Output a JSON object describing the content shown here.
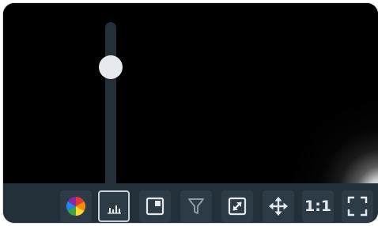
{
  "viewer": {
    "brightness_slider_level": 0.25
  },
  "toolbar": {
    "tools": [
      {
        "icon": "color-wheel-icon",
        "active": false
      },
      {
        "icon": "histogram-icon",
        "active": true
      },
      {
        "icon": "picture-in-picture-icon",
        "active": false
      },
      {
        "icon": "filter-icon",
        "active": false
      },
      {
        "icon": "resize-icon",
        "active": false
      },
      {
        "icon": "move-icon",
        "active": false
      },
      {
        "icon": "actual-size-icon",
        "label": "1:1",
        "active": false
      },
      {
        "icon": "fit-screen-icon",
        "active": false
      }
    ]
  },
  "colors": {
    "toolbar_bg": "#23303a",
    "button_bg": "#2c3b46",
    "icon": "#e4e9ee",
    "slider_track": "#243038",
    "slider_thumb": "#e6eaee"
  }
}
